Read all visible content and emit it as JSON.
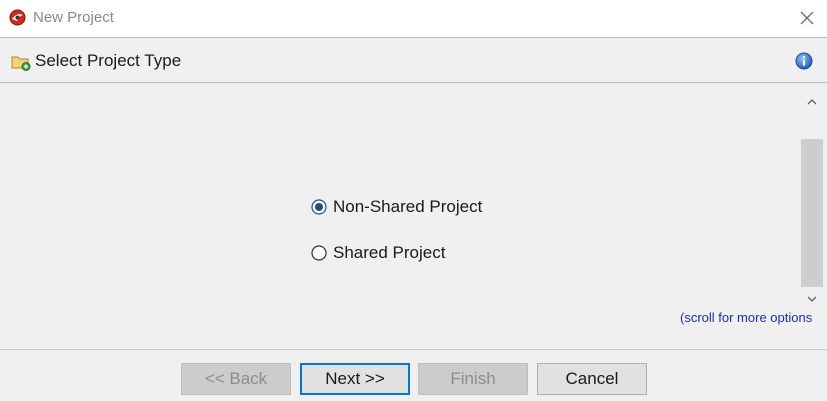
{
  "window": {
    "title": "New Project",
    "icon": "app-logo-icon",
    "close_icon": "close-icon"
  },
  "header": {
    "title": "Select Project Type",
    "icon": "new-folder-icon",
    "info_icon": "info-icon"
  },
  "options": [
    {
      "label": "Non-Shared Project",
      "selected": true
    },
    {
      "label": "Shared Project",
      "selected": false
    }
  ],
  "scroll_hint": "(scroll for more options",
  "buttons": {
    "back": "<< Back",
    "next": "Next >>",
    "finish": "Finish",
    "cancel": "Cancel"
  },
  "colors": {
    "accent": "#0078d7",
    "radio_selected": "#1f4e8c",
    "hint_text": "#1a2fb0"
  }
}
